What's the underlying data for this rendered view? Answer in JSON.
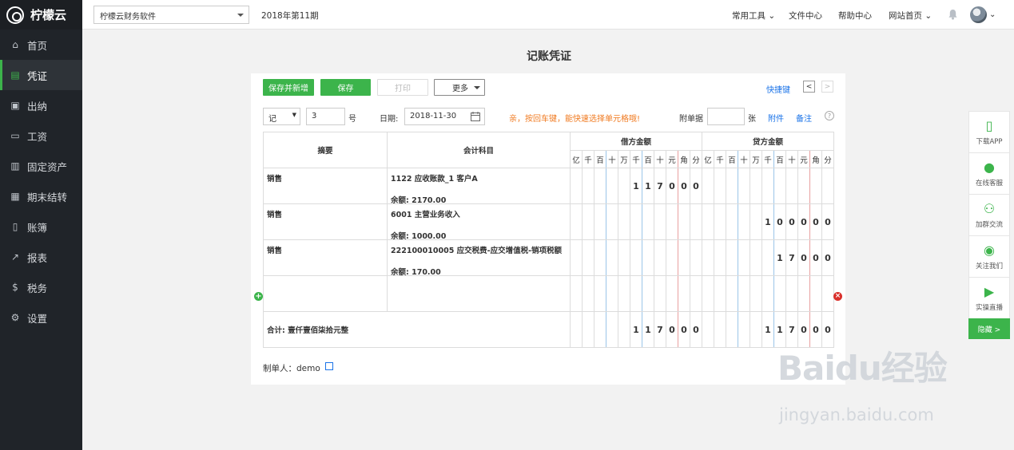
{
  "app": {
    "name": "柠檬云",
    "company": "柠檬云财务软件",
    "period": "2018年第11期"
  },
  "sidebar": {
    "items": [
      {
        "label": "首页",
        "icon": "home-icon"
      },
      {
        "label": "凭证",
        "icon": "document-icon",
        "active": true
      },
      {
        "label": "出纳",
        "icon": "cashier-icon"
      },
      {
        "label": "工资",
        "icon": "card-icon"
      },
      {
        "label": "固定资产",
        "icon": "building-icon"
      },
      {
        "label": "期末结转",
        "icon": "calendar-icon"
      },
      {
        "label": "账簿",
        "icon": "book-icon"
      },
      {
        "label": "报表",
        "icon": "chart-icon"
      },
      {
        "label": "税务",
        "icon": "coin-icon"
      },
      {
        "label": "设置",
        "icon": "gear-icon"
      }
    ]
  },
  "topnav": {
    "tools": "常用工具",
    "files": "文件中心",
    "help": "帮助中心",
    "site": "网站首页"
  },
  "page": {
    "title": "记账凭证"
  },
  "toolbar": {
    "save_new": "保存并新增",
    "save": "保存",
    "print": "打印",
    "more": "更多",
    "shortcut": "快捷键",
    "prev": "<",
    "next": ">"
  },
  "voucher": {
    "word": "记",
    "number": "3",
    "number_unit": "号",
    "date_label": "日期:",
    "date": "2018-11-30",
    "hint": "亲，按回车键，能快速选择单元格哦!",
    "attach_label": "附单据",
    "attach_unit": "张",
    "attachment": "附件",
    "note": "备注",
    "help": "?"
  },
  "table": {
    "col_summary": "摘要",
    "col_account": "会计科目",
    "col_debit": "借方金额",
    "col_credit": "贷方金额",
    "digits": [
      "亿",
      "千",
      "百",
      "十",
      "万",
      "千",
      "百",
      "十",
      "元",
      "角",
      "分"
    ],
    "rows": [
      {
        "summary": "销售",
        "account": "1122 应收账款_1 客户A",
        "balance": "余额: 2170.00",
        "debit": [
          "",
          "",
          "",
          "",
          "",
          "1",
          "1",
          "7",
          "0",
          "0",
          "0"
        ],
        "credit": [
          "",
          "",
          "",
          "",
          "",
          "",
          "",
          "",
          "",
          "",
          ""
        ]
      },
      {
        "summary": "销售",
        "account": "6001 主营业务收入",
        "balance": "余额: 1000.00",
        "debit": [
          "",
          "",
          "",
          "",
          "",
          "",
          "",
          "",
          "",
          "",
          ""
        ],
        "credit": [
          "",
          "",
          "",
          "",
          "",
          "1",
          "0",
          "0",
          "0",
          "0",
          "0"
        ]
      },
      {
        "summary": "销售",
        "account": "222100010005 应交税费-应交增值税-销项税额",
        "balance": "余额: 170.00",
        "debit": [
          "",
          "",
          "",
          "",
          "",
          "",
          "",
          "",
          "",
          "",
          ""
        ],
        "credit": [
          "",
          "",
          "",
          "",
          "",
          "",
          "1",
          "7",
          "0",
          "0",
          "0"
        ]
      },
      {
        "summary": "",
        "account": "",
        "balance": "",
        "debit": [
          "",
          "",
          "",
          "",
          "",
          "",
          "",
          "",
          "",
          "",
          ""
        ],
        "credit": [
          "",
          "",
          "",
          "",
          "",
          "",
          "",
          "",
          "",
          "",
          ""
        ]
      }
    ],
    "total_label": "合计: 壹仟壹佰柒拾元整",
    "total_debit": [
      "",
      "",
      "",
      "",
      "",
      "1",
      "1",
      "7",
      "0",
      "0",
      "0"
    ],
    "total_credit": [
      "",
      "",
      "",
      "",
      "",
      "1",
      "1",
      "7",
      "0",
      "0",
      "0"
    ]
  },
  "footer": {
    "maker": "制单人：demo"
  },
  "right_panel": [
    {
      "label": "下载APP",
      "icon": "phone-icon"
    },
    {
      "label": "在线客服",
      "icon": "penguin-icon"
    },
    {
      "label": "加群交流",
      "icon": "group-icon"
    },
    {
      "label": "关注我们",
      "icon": "wechat-icon"
    },
    {
      "label": "实操直播",
      "icon": "video-icon"
    }
  ],
  "right_hide": "隐藏 >",
  "watermark": {
    "main": "Baidu经验",
    "sub": "jingyan.baidu.com"
  }
}
